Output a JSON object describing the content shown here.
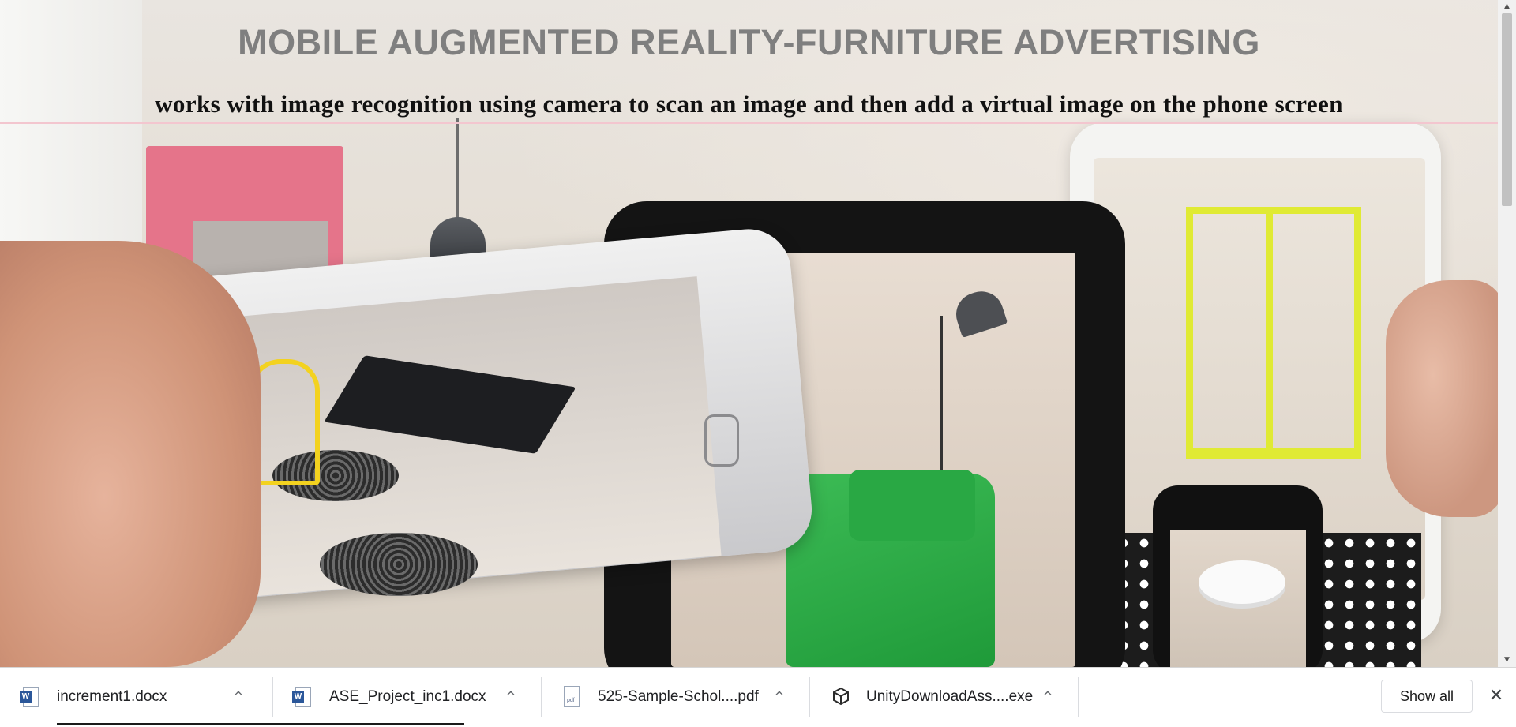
{
  "page": {
    "title": "MOBILE AUGMENTED REALITY-FURNITURE ADVERTISING",
    "subtitle": "works with image recognition using camera to scan an image and then add a virtual image on the phone screen",
    "hero_image": "ar-furniture-photo"
  },
  "scrollbar": {
    "up_arrow": "▲",
    "down_arrow": "▼"
  },
  "downloads": {
    "items": [
      {
        "name": "increment1.docx",
        "icon": "word-doc-icon",
        "chevron": "^"
      },
      {
        "name": "ASE_Project_inc1.docx",
        "icon": "word-doc-icon",
        "chevron": "^"
      },
      {
        "name": "525-Sample-Schol....pdf",
        "icon": "pdf-icon",
        "chevron": "^"
      },
      {
        "name": "UnityDownloadAss....exe",
        "icon": "unity-icon",
        "chevron": "^"
      }
    ],
    "show_all_label": "Show all",
    "close_glyph": "✕",
    "colors": {
      "word": "#2b579a",
      "progress": "#1a1a1a"
    }
  }
}
